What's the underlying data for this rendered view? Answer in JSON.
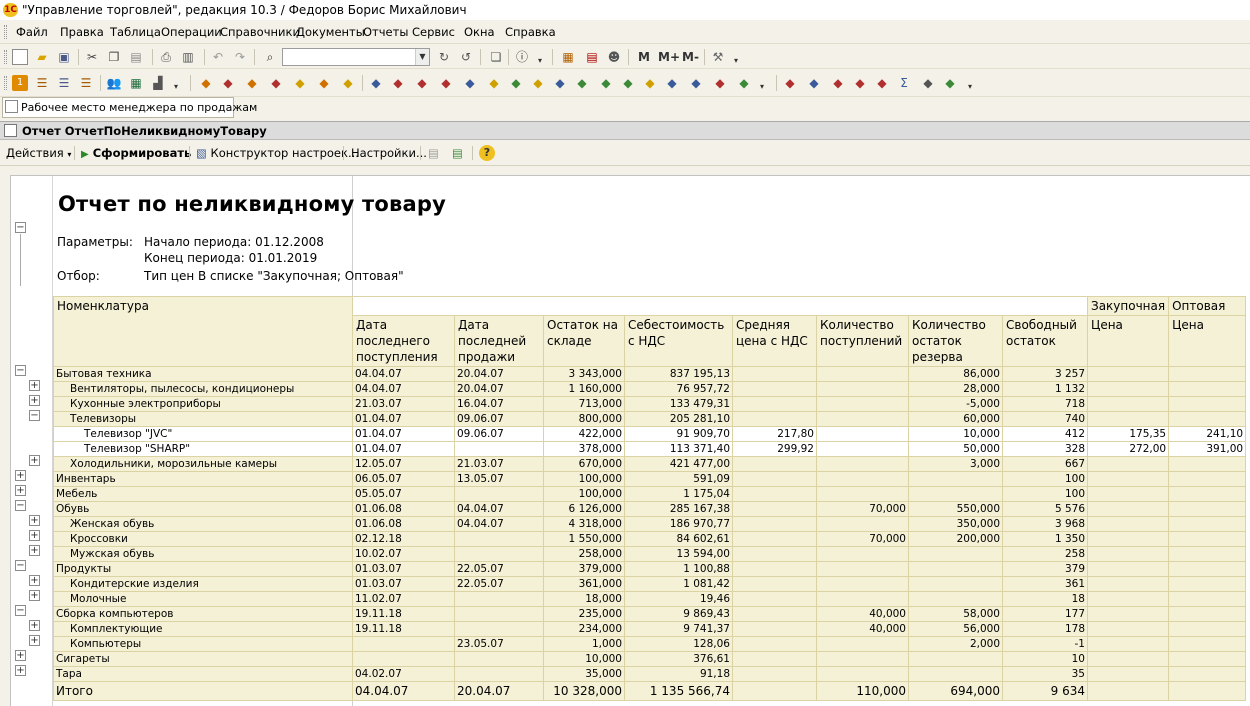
{
  "window": {
    "title": "\"Управление торговлей\", редакция 10.3 / Федоров Борис Михайлович",
    "logo": "1С"
  },
  "menu": [
    "Файл",
    "Правка",
    "Таблица",
    "Операции",
    "Справочники",
    "Документы",
    "Отчеты",
    "Сервис",
    "Окна",
    "Справка"
  ],
  "toolbar1": {
    "search_value": "",
    "m_buttons": [
      "M",
      "M+",
      "M-"
    ]
  },
  "window_tab": {
    "label": "Рабочее место менеджера по продажам"
  },
  "form": {
    "title": "Отчет  ОтчетПоНеликвидномуТовару"
  },
  "actions": {
    "actions_label": "Действия",
    "build_label": "Сформировать",
    "constructor_label": "Конструктор настроек...",
    "settings_label": "Настройки..."
  },
  "report": {
    "title": "Отчет по неликвидному товару",
    "params_label": "Параметры:",
    "start_label": "Начало периода: 01.12.2008",
    "end_label": "Конец   периода: 01.01.2019",
    "filter_label": "Отбор:",
    "filter_value": "Тип цен В списке \"Закупочная; Оптовая\"",
    "group_header": "Номенклатура",
    "price_headers": [
      "Закупочная",
      "Оптовая"
    ],
    "columns": [
      "Дата последнего поступления",
      "Дата последней продажи",
      "Остаток на складе",
      "Себестоимость с НДС",
      "Средняя цена с НДС",
      "Количество поступлений",
      "Количество остаток резерва",
      "Свободный остаток",
      "Цена",
      "Цена"
    ],
    "rows": [
      {
        "name": "Бытовая техника",
        "level": 0,
        "box": "minus",
        "v": [
          "04.04.07",
          "20.04.07",
          "3 343,000",
          "837 195,13",
          "",
          "",
          "86,000",
          "3 257",
          "",
          ""
        ]
      },
      {
        "name": "Вентиляторы, пылесосы, кондиционеры",
        "level": 1,
        "box": "plus",
        "v": [
          "04.04.07",
          "20.04.07",
          "1 160,000",
          "76 957,72",
          "",
          "",
          "28,000",
          "1 132",
          "",
          ""
        ]
      },
      {
        "name": "Кухонные электроприборы",
        "level": 1,
        "box": "plus",
        "v": [
          "21.03.07",
          "16.04.07",
          "713,000",
          "133 479,31",
          "",
          "",
          "-5,000",
          "718",
          "",
          ""
        ]
      },
      {
        "name": "Телевизоры",
        "level": 1,
        "box": "minus",
        "v": [
          "01.04.07",
          "09.06.07",
          "800,000",
          "205 281,10",
          "",
          "",
          "60,000",
          "740",
          "",
          ""
        ]
      },
      {
        "name": "Телевизор \"JVC\"",
        "level": 2,
        "box": "",
        "white": true,
        "v": [
          "01.04.07",
          "09.06.07",
          "422,000",
          "91 909,70",
          "217,80",
          "",
          "10,000",
          "412",
          "175,35",
          "241,10"
        ]
      },
      {
        "name": "Телевизор \"SHARP\"",
        "level": 2,
        "box": "",
        "white": true,
        "v": [
          "01.04.07",
          "",
          "378,000",
          "113 371,40",
          "299,92",
          "",
          "50,000",
          "328",
          "272,00",
          "391,00"
        ]
      },
      {
        "name": "Холодильники, морозильные камеры",
        "level": 1,
        "box": "plus",
        "v": [
          "12.05.07",
          "21.03.07",
          "670,000",
          "421 477,00",
          "",
          "",
          "3,000",
          "667",
          "",
          ""
        ]
      },
      {
        "name": "Инвентарь",
        "level": 0,
        "box": "plus",
        "v": [
          "06.05.07",
          "13.05.07",
          "100,000",
          "591,09",
          "",
          "",
          "",
          "100",
          "",
          ""
        ]
      },
      {
        "name": "Мебель",
        "level": 0,
        "box": "plus",
        "v": [
          "05.05.07",
          "",
          "100,000",
          "1 175,04",
          "",
          "",
          "",
          "100",
          "",
          ""
        ]
      },
      {
        "name": "Обувь",
        "level": 0,
        "box": "minus",
        "v": [
          "01.06.08",
          "04.04.07",
          "6 126,000",
          "285 167,38",
          "",
          "70,000",
          "550,000",
          "5 576",
          "",
          ""
        ]
      },
      {
        "name": "Женская обувь",
        "level": 1,
        "box": "plus",
        "v": [
          "01.06.08",
          "04.04.07",
          "4 318,000",
          "186 970,77",
          "",
          "",
          "350,000",
          "3 968",
          "",
          ""
        ]
      },
      {
        "name": "Кроссовки",
        "level": 1,
        "box": "plus",
        "v": [
          "02.12.18",
          "",
          "1 550,000",
          "84 602,61",
          "",
          "70,000",
          "200,000",
          "1 350",
          "",
          ""
        ]
      },
      {
        "name": "Мужская обувь",
        "level": 1,
        "box": "plus",
        "v": [
          "10.02.07",
          "",
          "258,000",
          "13 594,00",
          "",
          "",
          "",
          "258",
          "",
          ""
        ]
      },
      {
        "name": "Продукты",
        "level": 0,
        "box": "minus",
        "v": [
          "01.03.07",
          "22.05.07",
          "379,000",
          "1 100,88",
          "",
          "",
          "",
          "379",
          "",
          ""
        ]
      },
      {
        "name": "Кондитерские изделия",
        "level": 1,
        "box": "plus",
        "v": [
          "01.03.07",
          "22.05.07",
          "361,000",
          "1 081,42",
          "",
          "",
          "",
          "361",
          "",
          ""
        ]
      },
      {
        "name": "Молочные",
        "level": 1,
        "box": "plus",
        "v": [
          "11.02.07",
          "",
          "18,000",
          "19,46",
          "",
          "",
          "",
          "18",
          "",
          ""
        ]
      },
      {
        "name": "Сборка компьютеров",
        "level": 0,
        "box": "minus",
        "v": [
          "19.11.18",
          "",
          "235,000",
          "9 869,43",
          "",
          "40,000",
          "58,000",
          "177",
          "",
          ""
        ]
      },
      {
        "name": "Комплектующие",
        "level": 1,
        "box": "plus",
        "v": [
          "19.11.18",
          "",
          "234,000",
          "9 741,37",
          "",
          "40,000",
          "56,000",
          "178",
          "",
          ""
        ]
      },
      {
        "name": "Компьютеры",
        "level": 1,
        "box": "plus",
        "v": [
          "",
          "23.05.07",
          "1,000",
          "128,06",
          "",
          "",
          "2,000",
          "-1",
          "",
          ""
        ]
      },
      {
        "name": "Сигареты",
        "level": 0,
        "box": "plus",
        "v": [
          "",
          "",
          "10,000",
          "376,61",
          "",
          "",
          "",
          "10",
          "",
          ""
        ]
      },
      {
        "name": "Тара",
        "level": 0,
        "box": "plus",
        "v": [
          "04.02.07",
          "",
          "35,000",
          "91,18",
          "",
          "",
          "",
          "35",
          "",
          ""
        ]
      }
    ],
    "total": {
      "name": "Итого",
      "v": [
        "04.04.07",
        "20.04.07",
        "10 328,000",
        "1 135 566,74",
        "",
        "110,000",
        "694,000",
        "9 634",
        "",
        ""
      ]
    }
  }
}
